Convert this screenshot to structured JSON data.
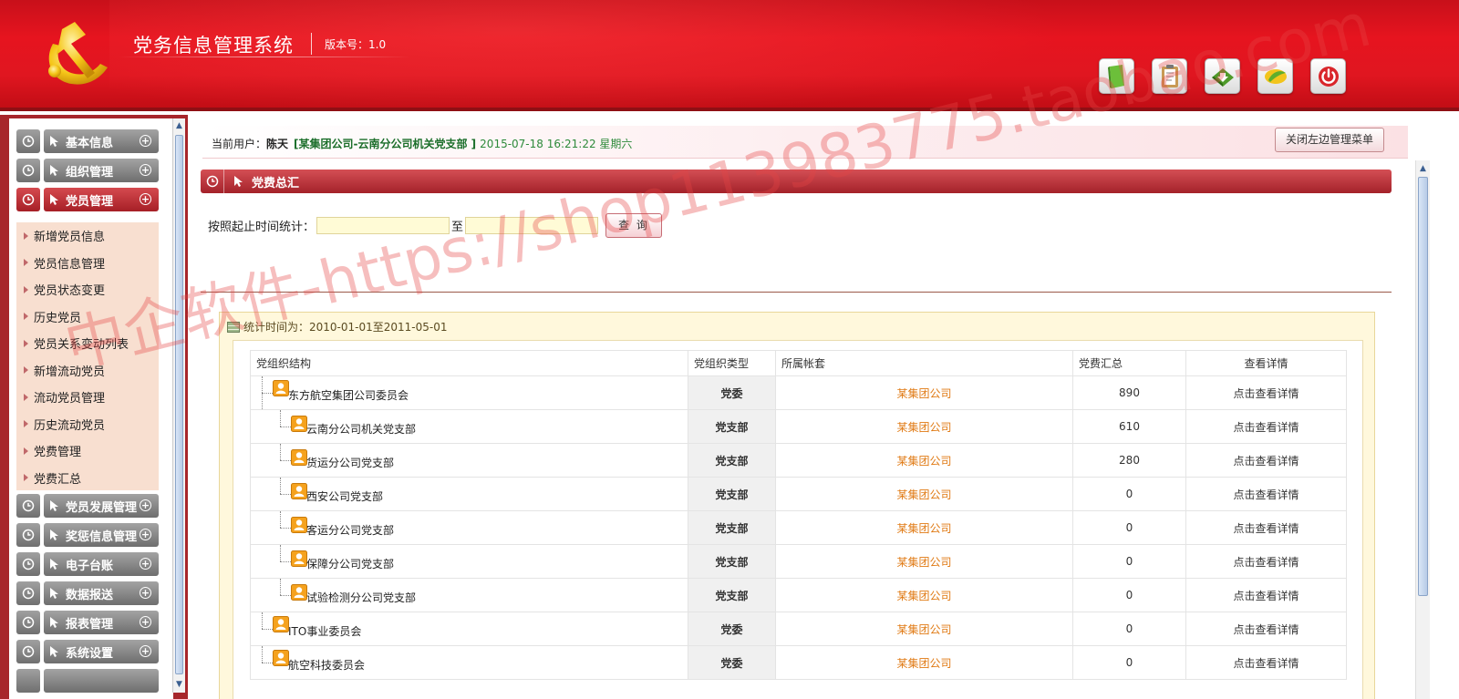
{
  "header": {
    "title": "党务信息管理系统",
    "version": "版本号：1.0",
    "icons": [
      "book-icon",
      "clipboard-icon",
      "download-icon",
      "leaf-icon",
      "power-icon"
    ]
  },
  "sidebar": {
    "top_menus": [
      {
        "label": "基本信息"
      },
      {
        "label": "组织管理"
      },
      {
        "label": "党员管理"
      }
    ],
    "submenu": [
      "新增党员信息",
      "党员信息管理",
      "党员状态变更",
      "历史党员",
      "党员关系变动列表",
      "新增流动党员",
      "流动党员管理",
      "历史流动党员",
      "党费管理",
      "党费汇总"
    ],
    "bottom_menus": [
      {
        "label": "党员发展管理"
      },
      {
        "label": "奖惩信息管理"
      },
      {
        "label": "电子台账"
      },
      {
        "label": "数据报送"
      },
      {
        "label": "报表管理"
      },
      {
        "label": "系统设置"
      }
    ]
  },
  "userbar": {
    "prefix": "当前用户：",
    "user": "陈天",
    "org": "[某集团公司-云南分公司机关党支部 ]",
    "datetime": "2015-07-18 16:21:22 星期六",
    "close_button": "关闭左边管理菜单"
  },
  "section": {
    "title": "党费总汇"
  },
  "search": {
    "label": "按照起止时间统计：",
    "start_value": "",
    "to": "至",
    "end_value": "",
    "query_button": "查 询"
  },
  "stats": {
    "title": "统计时间为：2010-01-01至2011-05-01",
    "columns": [
      "党组织结构",
      "党组织类型",
      "所属帐套",
      "党费汇总",
      "查看详情"
    ],
    "rows": [
      {
        "org": "东方航空集团公司委员会",
        "level": 1,
        "type": "党委",
        "account": "某集团公司",
        "sum": "890",
        "detail": "点击查看详情"
      },
      {
        "org": "云南分公司机关党支部",
        "level": 2,
        "type": "党支部",
        "account": "某集团公司",
        "sum": "610",
        "detail": "点击查看详情"
      },
      {
        "org": "货运分公司党支部",
        "level": 2,
        "type": "党支部",
        "account": "某集团公司",
        "sum": "280",
        "detail": "点击查看详情"
      },
      {
        "org": "西安公司党支部",
        "level": 2,
        "type": "党支部",
        "account": "某集团公司",
        "sum": "0",
        "detail": "点击查看详情"
      },
      {
        "org": "客运分公司党支部",
        "level": 2,
        "type": "党支部",
        "account": "某集团公司",
        "sum": "0",
        "detail": "点击查看详情"
      },
      {
        "org": "保障分公司党支部",
        "level": 2,
        "type": "党支部",
        "account": "某集团公司",
        "sum": "0",
        "detail": "点击查看详情"
      },
      {
        "org": "试验检测分公司党支部",
        "level": 2,
        "type": "党支部",
        "account": "某集团公司",
        "sum": "0",
        "detail": "点击查看详情"
      },
      {
        "org": "ITO事业委员会",
        "level": 1,
        "type": "党委",
        "account": "某集团公司",
        "sum": "0",
        "detail": "点击查看详情"
      },
      {
        "org": "航空科技委员会",
        "level": 1,
        "type": "党委",
        "account": "某集团公司",
        "sum": "0",
        "detail": "点击查看详情"
      }
    ]
  },
  "watermark": "中企软件-https://shop113983775.taobao.com",
  "colors": {
    "header_red": "#e6141f",
    "sidebar_red": "#a7262b",
    "active_menu": "#c0373d",
    "account_orange": "#e07a14"
  }
}
